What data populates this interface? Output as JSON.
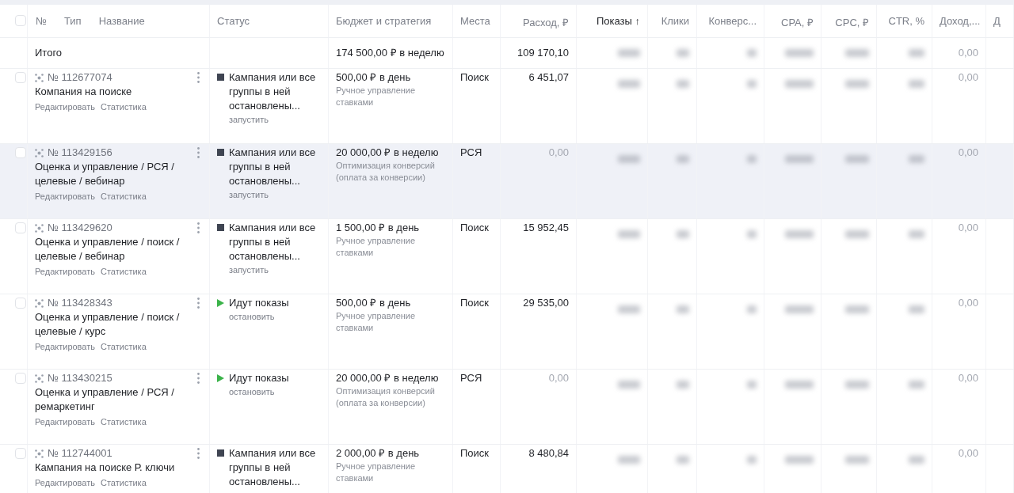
{
  "table": {
    "header_checkbox": {
      "checked": false
    },
    "columns": [
      {
        "label": "№",
        "sorted": false
      },
      {
        "label": "Тип",
        "sorted": false
      },
      {
        "label": "Название",
        "sorted": false
      },
      {
        "label": "Статус",
        "sorted": false
      },
      {
        "label": "Бюджет и стратегия",
        "sorted": false
      },
      {
        "label": "Места",
        "sorted": false
      },
      {
        "label": "Расход, ₽",
        "sorted": false
      },
      {
        "label": "Показы ↑",
        "sorted": true
      },
      {
        "label": "Клики",
        "sorted": false
      },
      {
        "label": "Конверс...",
        "sorted": false
      },
      {
        "label": "CPA, ₽",
        "sorted": false
      },
      {
        "label": "CPC, ₽",
        "sorted": false
      },
      {
        "label": "CTR, %",
        "sorted": false
      },
      {
        "label": "Доход,...",
        "sorted": false
      },
      {
        "label": "Д",
        "sorted": false
      }
    ],
    "total": {
      "label": "Итого",
      "budget": "174 500,00 ₽ в неделю",
      "expense": "109 170,10",
      "income": "0,00"
    },
    "rows": [
      {
        "checked": false,
        "selected": false,
        "number": "№ 112677074",
        "name": "Компания на поиске",
        "edit": "Редактировать",
        "stats": "Статистика",
        "status": {
          "kind": "stopped",
          "text": "Кампания или все группы в ней остановлены...",
          "action": "запустить"
        },
        "budget": "500,00 ₽ в день",
        "strategy": "Ручное управление ставками",
        "places": "Поиск",
        "expense": {
          "value": "6 451,07",
          "muted": false
        },
        "income": "0,00"
      },
      {
        "checked": false,
        "selected": true,
        "number": "№ 113429156",
        "name": "Оценка и управление / РСЯ / целевые / вебинар",
        "edit": "Редактировать",
        "stats": "Статистика",
        "status": {
          "kind": "stopped",
          "text": "Кампания или все группы в ней остановлены...",
          "action": "запустить"
        },
        "budget": "20 000,00 ₽ в неделю",
        "strategy": "Оптимизация конверсий (оплата за конверсии)",
        "places": "РСЯ",
        "expense": {
          "value": "0,00",
          "muted": true
        },
        "income": "0,00"
      },
      {
        "checked": false,
        "selected": false,
        "number": "№ 113429620",
        "name": "Оценка и управление / поиск / целевые / вебинар",
        "edit": "Редактировать",
        "stats": "Статистика",
        "status": {
          "kind": "stopped",
          "text": "Кампания или все группы в ней остановлены...",
          "action": "запустить"
        },
        "budget": "1 500,00 ₽ в день",
        "strategy": "Ручное управление ставками",
        "places": "Поиск",
        "expense": {
          "value": "15 952,45",
          "muted": false
        },
        "income": "0,00"
      },
      {
        "checked": false,
        "selected": false,
        "number": "№ 113428343",
        "name": "Оценка и управление / поиск / целевые / курс",
        "edit": "Редактировать",
        "stats": "Статистика",
        "status": {
          "kind": "running",
          "text": "Идут показы",
          "action": "остановить"
        },
        "budget": "500,00 ₽ в день",
        "strategy": "Ручное управление ставками",
        "places": "Поиск",
        "expense": {
          "value": "29 535,00",
          "muted": false
        },
        "income": "0,00"
      },
      {
        "checked": false,
        "selected": false,
        "number": "№ 113430215",
        "name": "Оценка и управление / РСЯ / ремаркетинг",
        "edit": "Редактировать",
        "stats": "Статистика",
        "status": {
          "kind": "running",
          "text": "Идут показы",
          "action": "остановить"
        },
        "budget": "20 000,00 ₽ в неделю",
        "strategy": "Оптимизация конверсий (оплата за конверсии)",
        "places": "РСЯ",
        "expense": {
          "value": "0,00",
          "muted": true
        },
        "income": "0,00"
      },
      {
        "checked": false,
        "selected": false,
        "number": "№ 112744001",
        "name": "Кампания на поиске Р. ключи",
        "edit": "Редактировать",
        "stats": "Статистика",
        "status": {
          "kind": "stopped",
          "text": "Кампания или все группы в ней остановлены..."
        },
        "budget": "2 000,00 ₽ в день",
        "strategy": "Ручное управление ставками",
        "places": "Поиск",
        "expense": {
          "value": "8 480,84",
          "muted": false
        },
        "income": "0,00"
      }
    ]
  }
}
